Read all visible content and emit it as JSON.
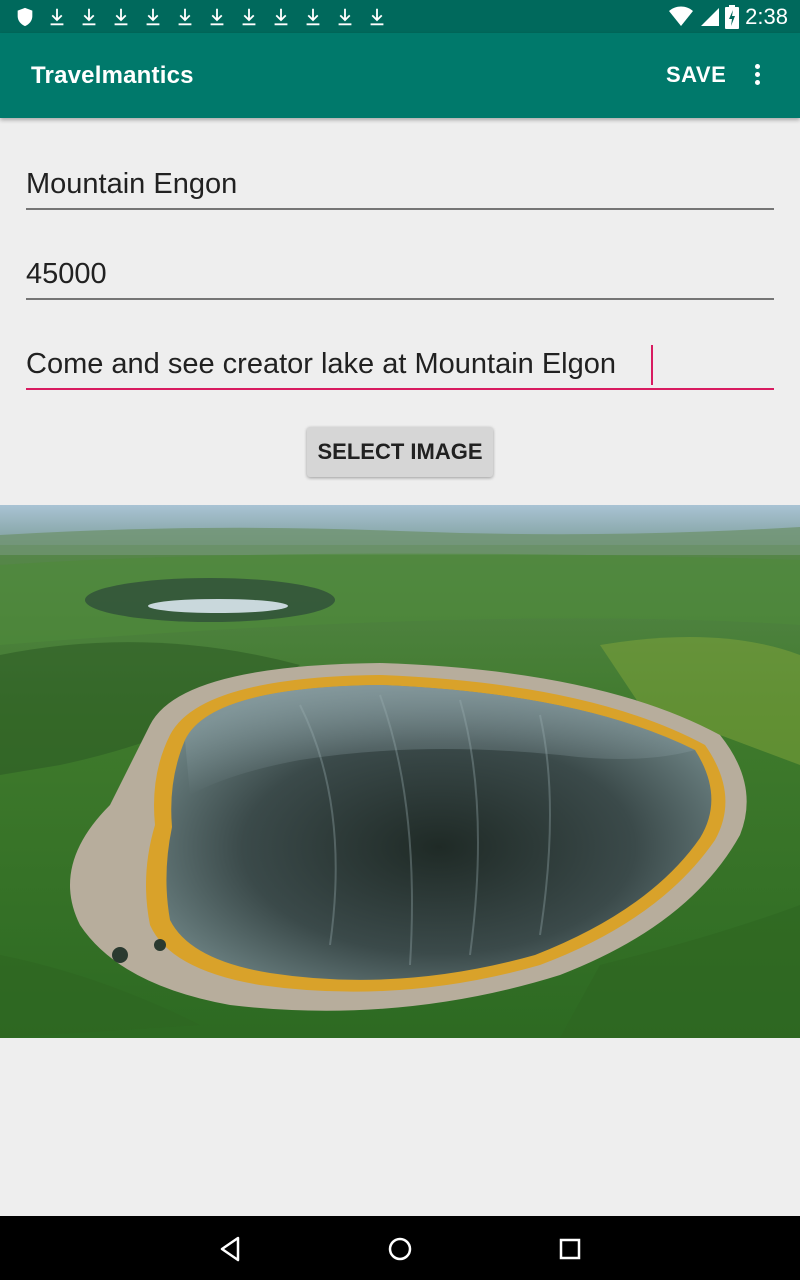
{
  "status_bar": {
    "time": "2:38",
    "left_icons": [
      "shield-icon",
      "download-icon",
      "download-icon",
      "download-icon",
      "download-icon",
      "download-icon",
      "download-icon",
      "download-icon",
      "download-icon",
      "download-icon",
      "download-icon",
      "download-icon"
    ],
    "right_icons": [
      "wifi-icon",
      "signal-icon",
      "battery-icon"
    ]
  },
  "app_bar": {
    "title": "Travelmantics",
    "save_label": "SAVE",
    "overflow_icon": "more-vert-icon"
  },
  "form": {
    "title_value": "Mountain Engon",
    "price_value": "45000",
    "description_value": "Come and see creator lake at Mountain Elgon",
    "select_image_label": "SELECT IMAGE"
  },
  "image": {
    "subject": "crater-lake-photo"
  },
  "nav_bar": {
    "icons": [
      "back-icon",
      "home-icon",
      "recents-icon"
    ]
  },
  "colors": {
    "status_bar": "#00695c",
    "app_bar": "#00796b",
    "accent": "#d81b60",
    "background": "#eeeeee"
  }
}
